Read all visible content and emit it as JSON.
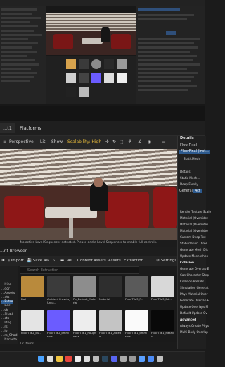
{
  "colors": {
    "accent_blue": "#2d5a8e",
    "accent_yellow": "#e5b93a",
    "seat_red": "#8e1717",
    "panel_bg": "#202020"
  },
  "editor": {
    "tabs": [
      "...t1",
      "Platforms"
    ]
  },
  "viewport_toolbar": {
    "mode": "Perspective",
    "lit": "Lit",
    "show": "Show",
    "scalability": "Scalability: High"
  },
  "viewport_message": "No active Level Sequencer detected. Please add a Level Sequencer to enable full controls.",
  "content_browser": {
    "tab": "...nt Browser",
    "toolbar": {
      "import": "Import",
      "save_all": "Save All",
      "breadcrumb": [
        "All",
        "Content",
        "Assets",
        "Assets",
        "Extraction"
      ],
      "settings": "Settings"
    },
    "search_placeholder": "Search Extraction",
    "folders": [
      "...ltion",
      "...dor",
      "...Assets",
      "...ets",
      "...Extra",
      "...Res",
      "...ck",
      "...Shad",
      "...cts",
      "...ldng",
      "...rs",
      "...lo",
      "...rs_Shad",
      "...haracte"
    ],
    "assets": [
      {
        "label": "Doll",
        "color": "#b98a3c"
      },
      {
        "label": "Ambient Presets_Unca...",
        "color": "#3b3b3b"
      },
      {
        "label": "Pb_Default_Material",
        "color": "#8d8d8d"
      },
      {
        "label": "Material",
        "color": "#2e2e2e"
      },
      {
        "label": "FloorTile3_F...",
        "color": "#5a5a5a"
      },
      {
        "label": "FloorTile3_Ed...",
        "color": "#d8d8d8"
      },
      {
        "label": "FloorTile2_Bu...",
        "color": "#e4e4e4"
      },
      {
        "label": "FloorTile2_Emmisive",
        "color": "#6b5cff"
      },
      {
        "label": "FloorTile1_Roughness",
        "color": "#ededed"
      },
      {
        "label": "FloorTile1_Albedo",
        "color": "#c4c4c4"
      },
      {
        "label": "FloorTile1_Emmisive",
        "color": "#fafafa"
      },
      {
        "label": "FloorTile1_Metallic",
        "color": "#090909"
      }
    ],
    "item_count": "12 items"
  },
  "details": {
    "title": "Details",
    "actor": "FloorFinal",
    "component": "FloorFinal (Inst...",
    "child": "StaticMesh",
    "tabs": [
      "General",
      "Act"
    ],
    "rows": [
      "Details",
      "Static Mesh...",
      "Deep Family",
      "Render Texture Scale",
      "Material (Override)",
      "Material (Override)",
      "Material (Override)",
      "Custom Deep Tex",
      "Stabilization Thres",
      "Generate Mesh Dis",
      "Update Mesh when",
      "Collision",
      "Generate Overlap E",
      "Can Character Step",
      "Collision Presets",
      "Simulation Generat",
      "Phys Material Over",
      "Generate Overlap E",
      "Update Overlaps M",
      "Default Update Ov",
      "Advanced",
      "Always Create Phys",
      "Multi Body Overlap"
    ]
  },
  "top_thumbnail_colors": [
    "#d7a34d",
    "#8b8b8b",
    "#555",
    "#9a9a9a",
    "#cfcfcf",
    "#444",
    "#6b5cff",
    "#ddd",
    "#efefef",
    "#222",
    "#bbb",
    "#5a5a5a"
  ],
  "taskbar_icons": [
    "windows",
    "search",
    "file-explorer",
    "chrome",
    "epic-games",
    "unreal",
    "unity",
    "steam",
    "discord",
    "terminal",
    "settings",
    "photos",
    "mail",
    "app"
  ]
}
